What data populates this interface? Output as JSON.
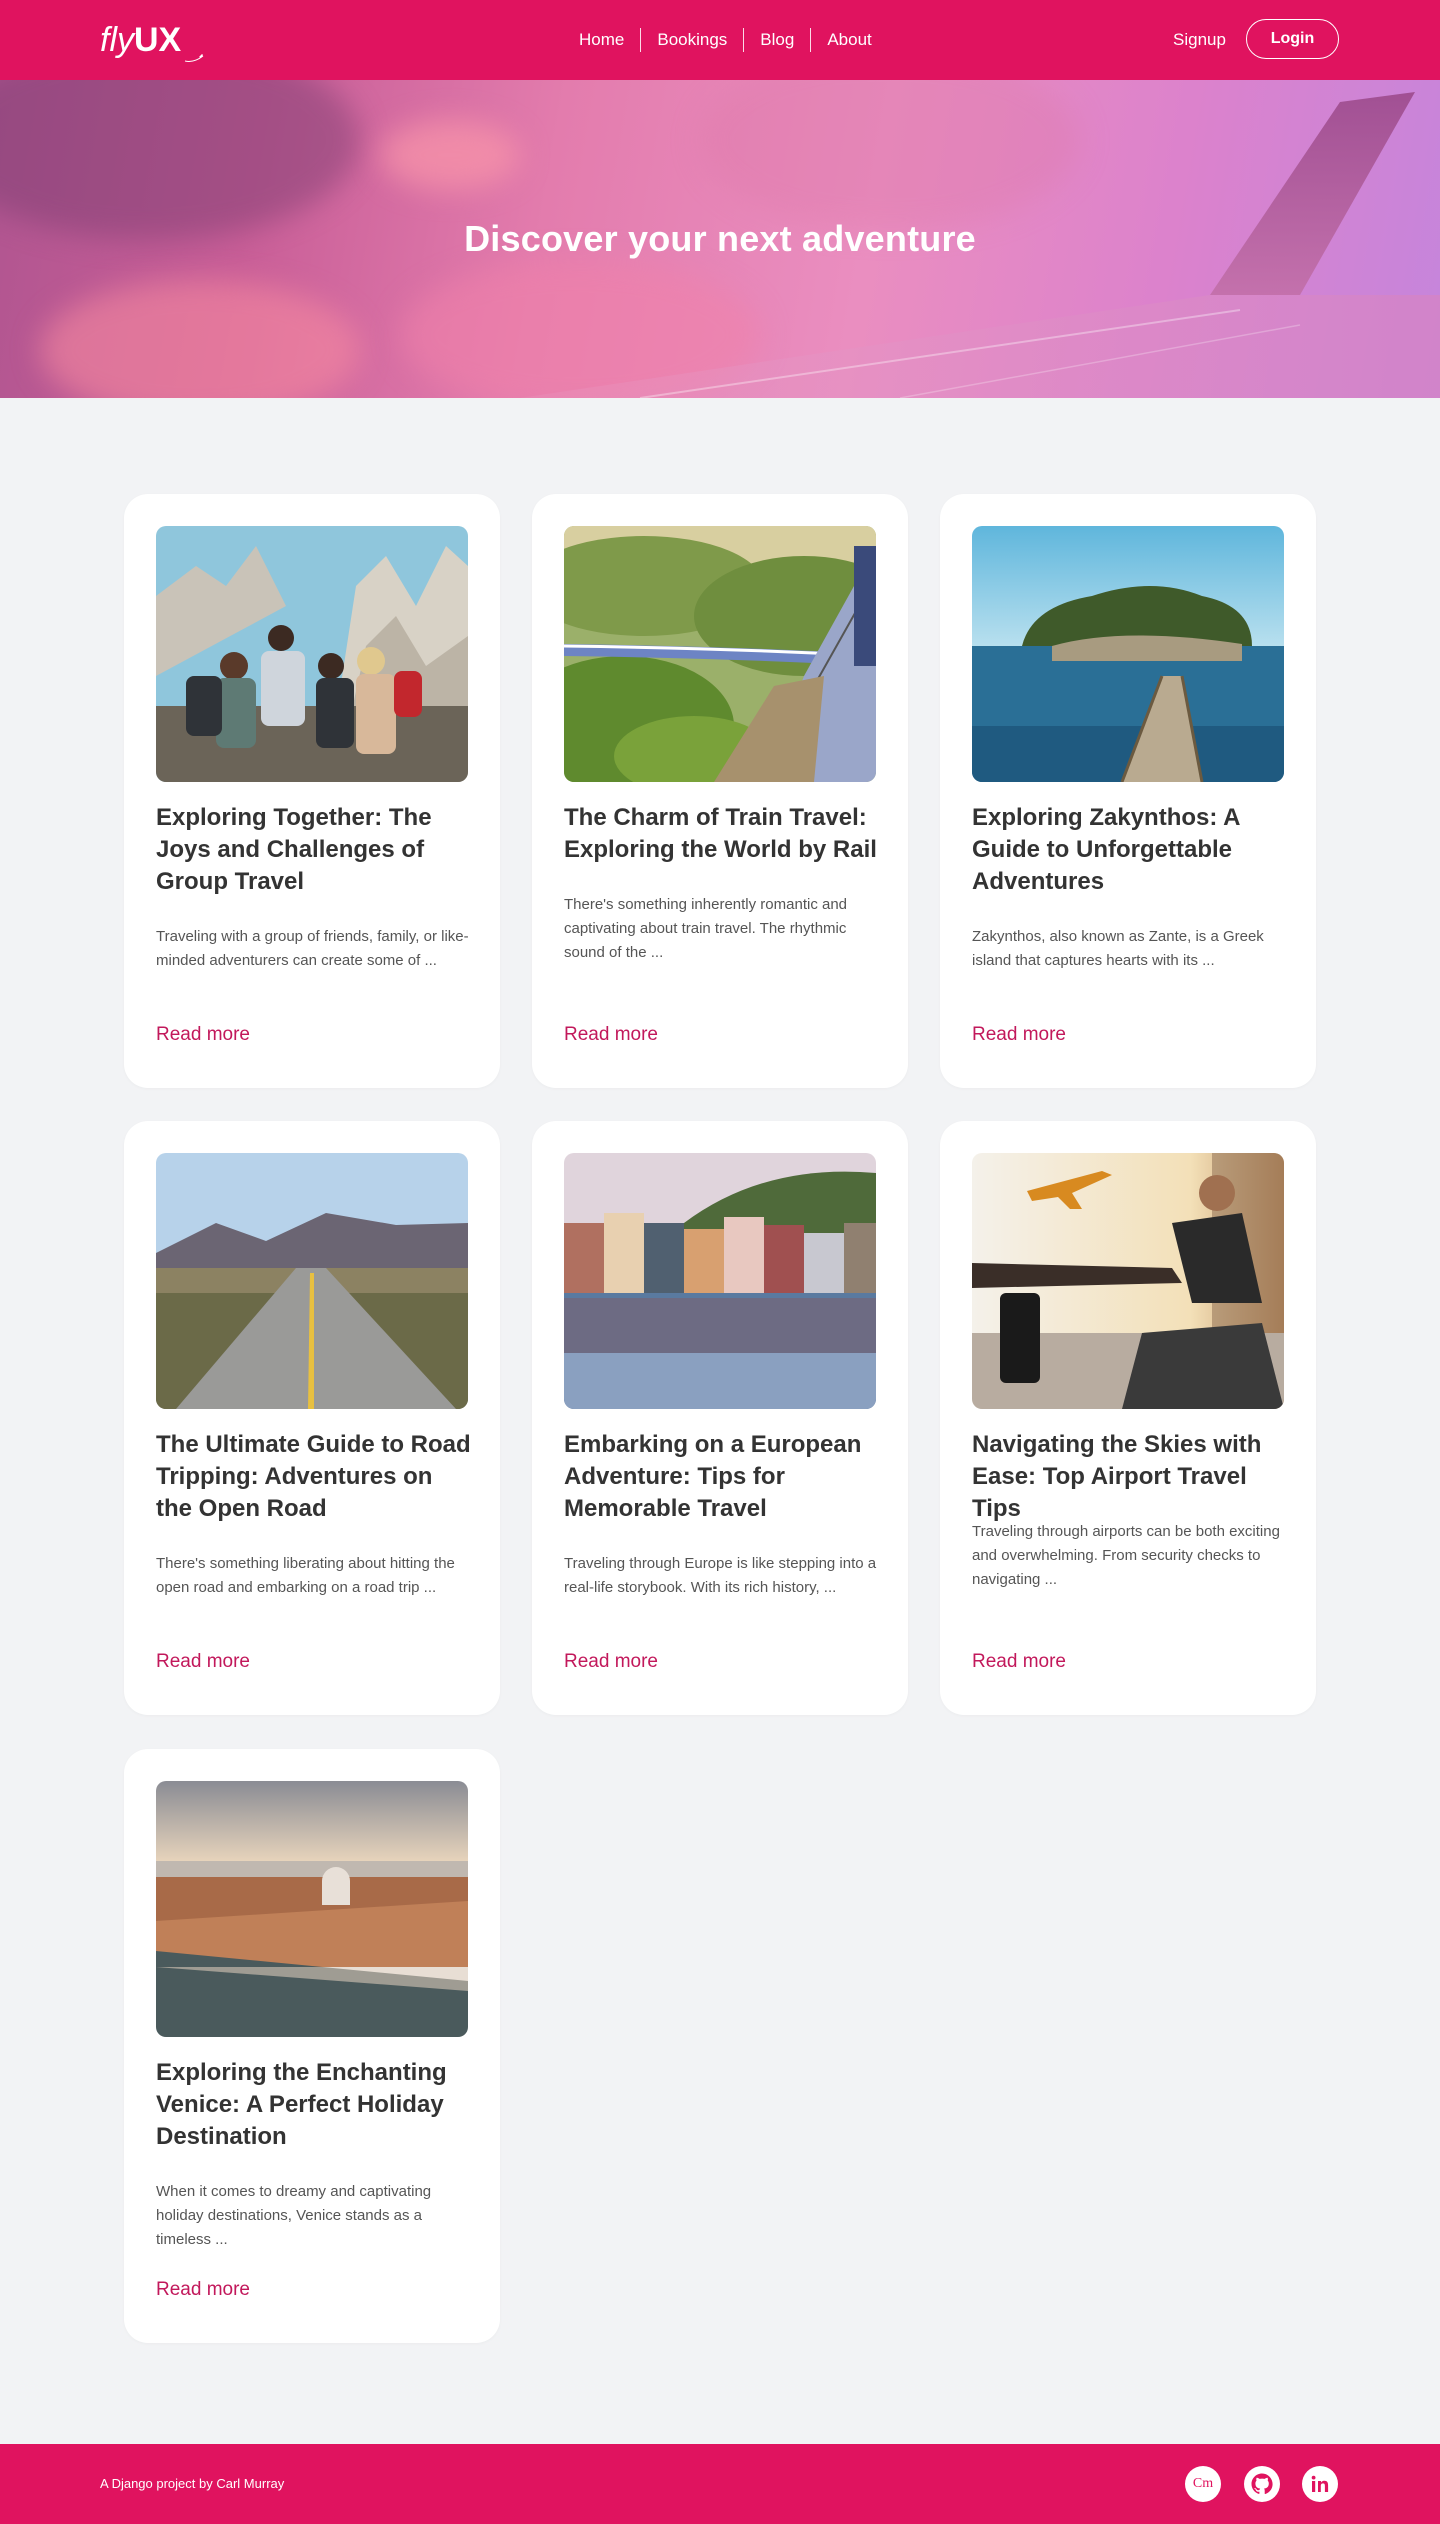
{
  "nav": {
    "logo_fly": "fly",
    "logo_ux": "UX",
    "links": [
      "Home",
      "Bookings",
      "Blog",
      "About"
    ],
    "signup": "Signup",
    "login": "Login"
  },
  "hero": {
    "title": "Discover your next adventure"
  },
  "posts": [
    {
      "title": "Exploring Together: The Joys and Challenges of Group Travel",
      "excerpt": "Traveling with a group of friends, family, or like-minded adventurers can create some of ...",
      "read_more": "Read more",
      "image": "group-hikers-mountains"
    },
    {
      "title": "The Charm of Train Travel: Exploring the World by Rail",
      "excerpt": "There's something inherently romantic and captivating about train travel. The rhythmic sound of the ...",
      "read_more": "Read more",
      "image": "train-through-forest"
    },
    {
      "title": "Exploring Zakynthos: A Guide to Unforgettable Adventures",
      "excerpt": "Zakynthos, also known as Zante, is a Greek island that captures hearts with its ...",
      "read_more": "Read more",
      "image": "island-pier"
    },
    {
      "title": "The Ultimate Guide to Road Tripping: Adventures on the Open Road",
      "excerpt": "There's something liberating about hitting the open road and embarking on a road trip ...",
      "read_more": "Read more",
      "image": "desert-road"
    },
    {
      "title": "Embarking on a European Adventure: Tips for Memorable Travel",
      "excerpt": "Traveling through Europe is like stepping into a real-life storybook. With its rich history, ...",
      "read_more": "Read more",
      "image": "european-riverside-town"
    },
    {
      "title": "Navigating the Skies with Ease: Top Airport Travel Tips",
      "excerpt": "Traveling through airports can be both exciting and overwhelming. From security checks to navigating ...",
      "read_more": "Read more",
      "image": "airport-lounge-traveler"
    },
    {
      "title": "Exploring the Enchanting Venice: A Perfect Holiday Destination",
      "excerpt": "When it comes to dreamy and captivating holiday destinations, Venice stands as a timeless ...",
      "read_more": "Read more",
      "image": "venice-aerial"
    }
  ],
  "footer": {
    "prefix": "A Django project by ",
    "author": "Carl Murray",
    "social": [
      "codementor-icon",
      "github-icon",
      "linkedin-icon"
    ],
    "cm_label": "Cm"
  },
  "colors": {
    "brand": "#e0135f",
    "link": "#c2185b",
    "background": "#f2f3f5"
  }
}
